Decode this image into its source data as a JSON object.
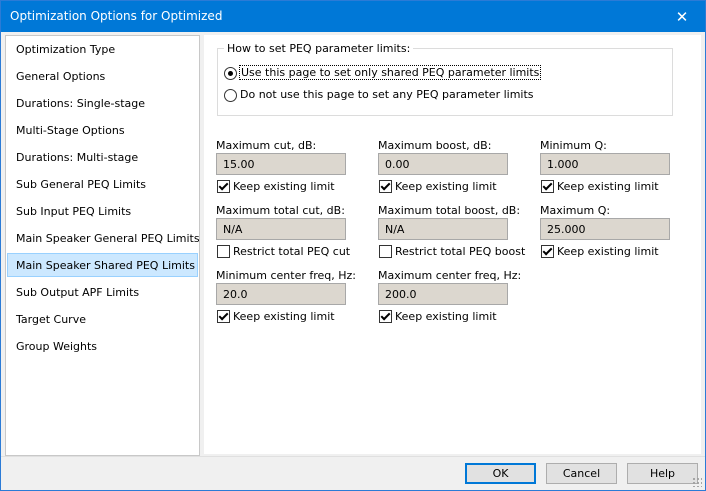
{
  "window": {
    "title": "Optimization Options for Optimized"
  },
  "sidebar": {
    "items": [
      {
        "label": "Optimization Type"
      },
      {
        "label": "General Options"
      },
      {
        "label": "Durations: Single-stage"
      },
      {
        "label": "Multi-Stage Options"
      },
      {
        "label": "Durations: Multi-stage"
      },
      {
        "label": "Sub General PEQ Limits"
      },
      {
        "label": "Sub Input PEQ Limits"
      },
      {
        "label": "Main Speaker General PEQ Limits"
      },
      {
        "label": "Main Speaker Shared PEQ Limits"
      },
      {
        "label": "Sub Output APF Limits"
      },
      {
        "label": "Target Curve"
      },
      {
        "label": "Group Weights"
      }
    ],
    "selected": "Main Speaker Shared PEQ Limits"
  },
  "group": {
    "label": "How to set PEQ parameter limits:",
    "options": [
      {
        "label": "Use this page to set only shared PEQ parameter limits",
        "checked": true
      },
      {
        "label": "Do not use this page to set any PEQ parameter limits",
        "checked": false
      }
    ]
  },
  "fields": {
    "max_cut": {
      "label": "Maximum cut, dB:",
      "value": "15.00",
      "check_label": "Keep existing limit",
      "checked": true
    },
    "max_boost": {
      "label": "Maximum boost, dB:",
      "value": "0.00",
      "check_label": "Keep existing limit",
      "checked": true
    },
    "min_q": {
      "label": "Minimum Q:",
      "value": "1.000",
      "check_label": "Keep existing limit",
      "checked": true
    },
    "max_total_cut": {
      "label": "Maximum total cut, dB:",
      "value": "N/A",
      "check_label": "Restrict total PEQ cut",
      "checked": false
    },
    "max_total_boost": {
      "label": "Maximum total boost, dB:",
      "value": "N/A",
      "check_label": "Restrict total PEQ boost",
      "checked": false
    },
    "max_q": {
      "label": "Maximum Q:",
      "value": "25.000",
      "check_label": "Keep existing limit",
      "checked": true
    },
    "min_center_freq": {
      "label": "Minimum center freq, Hz:",
      "value": "20.0",
      "check_label": "Keep existing limit",
      "checked": true
    },
    "max_center_freq": {
      "label": "Maximum center freq, Hz:",
      "value": "200.0",
      "check_label": "Keep existing limit",
      "checked": true
    }
  },
  "buttons": {
    "ok": "OK",
    "cancel": "Cancel",
    "help": "Help"
  },
  "colors": {
    "titlebar": "#0078d7",
    "selection": "#cce8ff",
    "field_bg": "#dcd7cf"
  }
}
